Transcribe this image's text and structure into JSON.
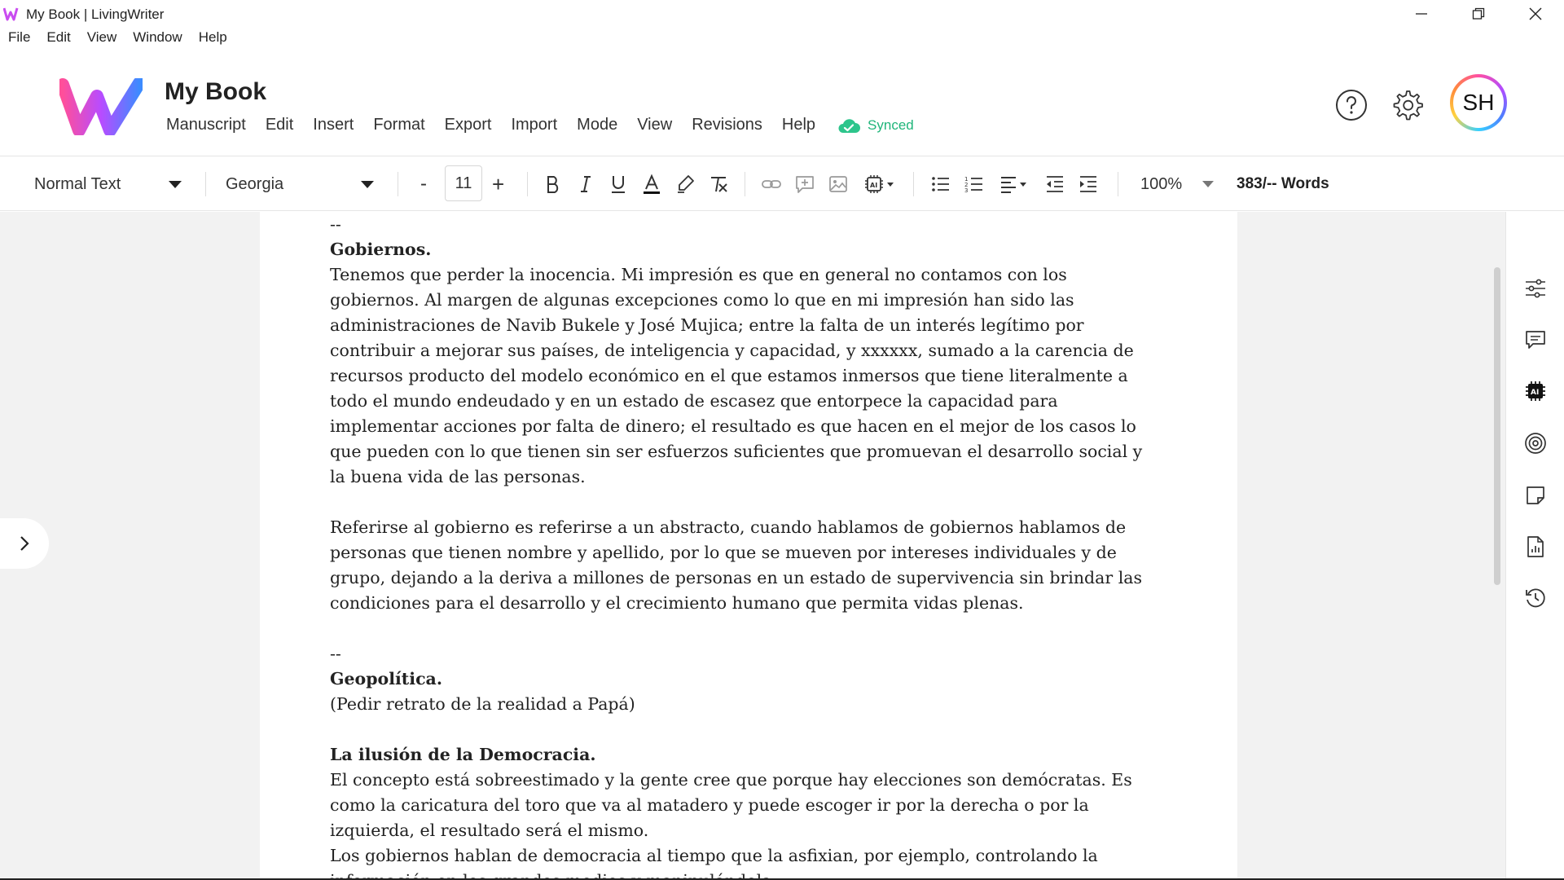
{
  "window": {
    "title": "My Book | LivingWriter"
  },
  "os_menu": [
    "File",
    "Edit",
    "View",
    "Window",
    "Help"
  ],
  "app": {
    "doc_title": "My Book",
    "menu": [
      "Manuscript",
      "Edit",
      "Insert",
      "Format",
      "Export",
      "Import",
      "Mode",
      "View",
      "Revisions",
      "Help"
    ],
    "sync_status": "Synced",
    "avatar_initials": "SH",
    "brand_colors": {
      "pink": "#ff4fa3",
      "purple": "#b14cff",
      "blue": "#4f7dff",
      "synced_green": "#1fb57a"
    }
  },
  "toolbar": {
    "paragraph_style": "Normal Text",
    "font_family": "Georgia",
    "font_size": "11",
    "decrease": "-",
    "increase": "+",
    "zoom": "100%",
    "word_count": "383/-- Words"
  },
  "document": {
    "blocks": [
      {
        "type": "text",
        "text": "--"
      },
      {
        "type": "heading",
        "text": "Gobiernos."
      },
      {
        "type": "text",
        "text": "Tenemos que perder la inocencia. Mi impresión es que en general no contamos con los gobiernos. Al margen de algunas excepciones como lo que en mi impresión han sido las administraciones de Navib Bukele y José Mujica; entre la falta de un interés legítimo por contribuir a mejorar sus países, de inteligencia y capacidad, y xxxxxx, sumado a la carencia de recursos producto del modelo económico en el que estamos inmersos que tiene literalmente a todo el mundo endeudado y en un estado de escasez que entorpece la capacidad para implementar acciones por falta de dinero; el resultado es que hacen en el mejor de los casos lo que pueden con lo que tienen sin ser esfuerzos suficientes que promuevan el desarrollo social y la buena vida de las personas."
      },
      {
        "type": "gap"
      },
      {
        "type": "text",
        "text": "Referirse al gobierno es referirse a un abstracto, cuando hablamos de gobiernos hablamos de personas que tienen nombre y apellido, por lo que se mueven por intereses individuales y de grupo, dejando a la deriva a millones de personas en un estado de supervivencia sin brindar las condiciones para el desarrollo y el crecimiento humano que permita vidas plenas."
      },
      {
        "type": "gap"
      },
      {
        "type": "text",
        "text": "--"
      },
      {
        "type": "heading",
        "text": "Geopolítica."
      },
      {
        "type": "text",
        "text": "(Pedir retrato de la realidad a Papá)"
      },
      {
        "type": "gap"
      },
      {
        "type": "heading",
        "text": "La ilusión de la Democracia."
      },
      {
        "type": "text",
        "text": "El concepto está sobreestimado y la gente cree que porque hay elecciones son demócratas. Es como la caricatura del toro que va al matadero y puede escoger ir por la derecha o por la izquierda, el resultado será el mismo."
      },
      {
        "type": "text",
        "text": "Los gobiernos hablan de democracia al tiempo que la asfixian, por ejemplo, controlando la información en los grandes medios y manipulándola."
      }
    ]
  },
  "right_rail": [
    "settings-sliders-icon",
    "comment-icon",
    "ai-chip-icon",
    "target-icon",
    "sticky-note-icon",
    "document-stats-icon",
    "history-icon"
  ]
}
